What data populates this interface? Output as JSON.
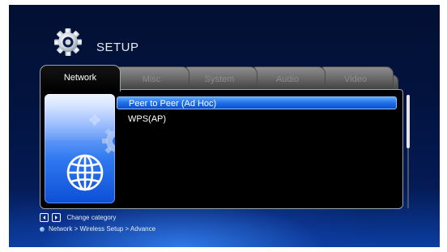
{
  "header": {
    "title": "SETUP",
    "icon": "gear-icon"
  },
  "tabs": [
    {
      "label": "Network",
      "active": true
    },
    {
      "label": "Misc",
      "active": false
    },
    {
      "label": "System",
      "active": false
    },
    {
      "label": "Audio",
      "active": false
    },
    {
      "label": "Video",
      "active": false
    }
  ],
  "side_card": {
    "icon": "globe-icon",
    "decor_icon": "gear-icon"
  },
  "menu": {
    "items": [
      {
        "label": "Peer to Peer (Ad Hoc)",
        "selected": true
      },
      {
        "label": "WPS(AP)",
        "selected": false
      }
    ]
  },
  "footer": {
    "hint_label": "Change category",
    "hint_icons": [
      "arrow-left-icon",
      "arrow-right-icon"
    ],
    "breadcrumb": "Network > Wireless Setup > Advance"
  },
  "colors": {
    "accent": "#1f6fe6",
    "background_top": "#031033",
    "background_glow": "#3c8cff",
    "tab_inactive": "#6c6c6c"
  }
}
